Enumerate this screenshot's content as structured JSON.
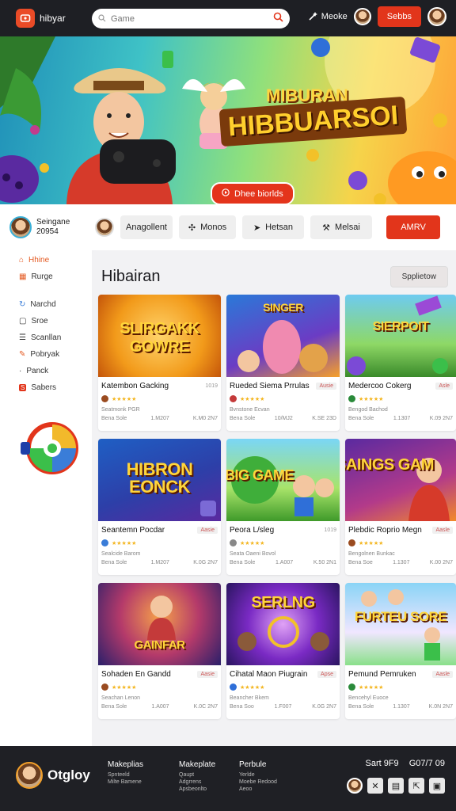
{
  "header": {
    "logo_text": "hibyar",
    "search_placeholder": "Game",
    "mode_label": "Meoke",
    "signin_label": "Sebbs"
  },
  "hero": {
    "subtitle": "MIBURAN",
    "title": "HIBBUARSOI",
    "cta_label": "Dhee biorlds"
  },
  "filters": {
    "user_line1": "Seingane",
    "user_line2": "20954",
    "chip1": "Anagollent",
    "chip2": "Monos",
    "chip3": "Hetsan",
    "chip4": "Melsai",
    "cta": "AMRV"
  },
  "sidebar": {
    "items": [
      {
        "label": "Hhine",
        "icon": "home-icon"
      },
      {
        "label": "Rurge",
        "icon": "grid-icon"
      },
      {
        "label": "Narchd",
        "icon": "refresh-icon"
      },
      {
        "label": "Sroe",
        "icon": "doc-icon"
      },
      {
        "label": "Scanllan",
        "icon": "list-icon"
      },
      {
        "label": "Pobryak",
        "icon": "pen-icon"
      },
      {
        "label": "Panck",
        "icon": "dot-icon"
      },
      {
        "label": "Sabers",
        "icon": "tag-icon"
      }
    ]
  },
  "main": {
    "title": "Hibairan",
    "sort_label": "Spplietow"
  },
  "cards": [
    {
      "thumb_text": "SLIRGAKK GOWRE",
      "title": "Katembon Gacking",
      "tag": "1019",
      "meta": "Seatmonk PGR",
      "foot_left": "Bena Sole",
      "foot_mid": "1.M207",
      "foot_right": "K.M0 2N7"
    },
    {
      "thumb_text": "SINGER",
      "title": "Rueded Siema Prrulas",
      "tag": "Ausie",
      "meta": "Bvnstone Ecvan",
      "foot_left": "Bena Sole",
      "foot_mid": "10/MJ2",
      "foot_right": "K.SE 23D"
    },
    {
      "thumb_text": "SIERPOIT",
      "title": "Medercoo Cokerg",
      "tag": "Asle",
      "meta": "Bengod Bachod",
      "foot_left": "Bena Sole",
      "foot_mid": "1.1307",
      "foot_right": "K.09 2N7"
    },
    {
      "thumb_text": "HIBRON EONCK",
      "title": "Seantemn Pocdar",
      "tag": "Aasie",
      "meta": "Sealcide Barom",
      "foot_left": "Bena Sole",
      "foot_mid": "1.M207",
      "foot_right": "K.0G 2N7"
    },
    {
      "thumb_text": "BIG GAME",
      "title": "Peora L/sleg",
      "tag": "1019",
      "meta": "Seata Oaeni Bovol",
      "foot_left": "Bena Sole",
      "foot_mid": "1.A007",
      "foot_right": "K.50 2N1"
    },
    {
      "thumb_text": "SAINGS GAM",
      "title": "Plebdic Roprio Megn",
      "tag": "Aasle",
      "meta": "Bengolnen Bunkac",
      "foot_left": "Bena Soe",
      "foot_mid": "1.1307",
      "foot_right": "K.00 2N7"
    },
    {
      "thumb_text": "GAINFAR",
      "title": "Sohaden En Gandd",
      "tag": "Aasie",
      "meta": "Seachan Lenon",
      "foot_left": "Bena Sole",
      "foot_mid": "1.A007",
      "foot_right": "K.0C 2N7"
    },
    {
      "thumb_text": "SERLNG",
      "title": "Cihatal Maon Piugrain",
      "tag": "Apse",
      "meta": "Beancher Bkem",
      "foot_left": "Bena Soo",
      "foot_mid": "1.F007",
      "foot_right": "K.0G 2N7"
    },
    {
      "thumb_text": "FURTEU SORE",
      "title": "Pemund Pemruken",
      "tag": "Aasle",
      "meta": "Bencehyl Euoce",
      "foot_left": "Bena Sole",
      "foot_mid": "1.1307",
      "foot_right": "K.0N 2N7"
    }
  ],
  "footer": {
    "brand": "Otgloy",
    "col1_head": "Makeplias",
    "col1_l1": "Spnteeld",
    "col1_l2": "Milte Bamene",
    "col2_head": "Makeplate",
    "col2_l1": "Qaupt",
    "col2_l2": "Adgrrens",
    "col2_l3": "Apsbeonlto",
    "col3_head": "Perbule",
    "col3_l1": "Yerlde",
    "col3_l2": "Moebe Redood",
    "col3_l3": "Aeoo",
    "stat_label": "Sart 9F9",
    "stat_value": "G07/7 09"
  },
  "colors": {
    "accent": "#e2351b",
    "dark": "#1e1f24",
    "highlight": "#e45a22"
  }
}
